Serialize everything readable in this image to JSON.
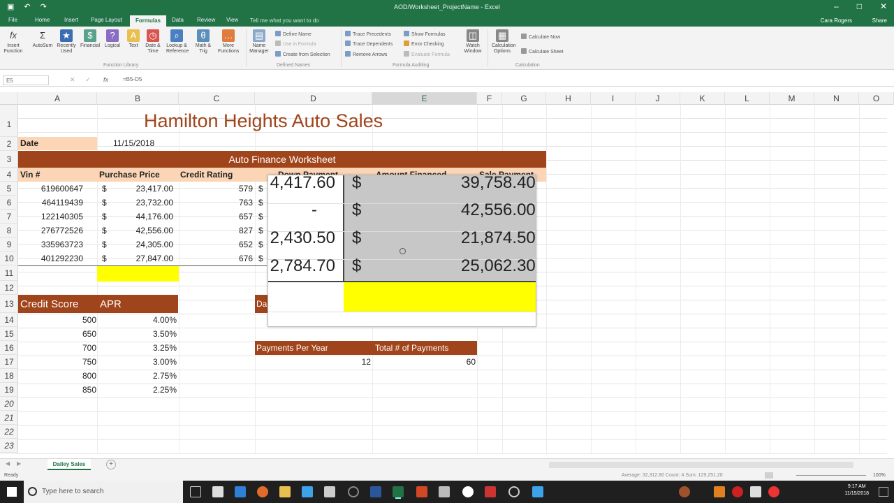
{
  "window": {
    "title": "AOD/Worksheet_ProjectName - Excel",
    "user": "Cara Rogers",
    "share": "Share"
  },
  "tabs": [
    "File",
    "Home",
    "Insert",
    "Page Layout",
    "Formulas",
    "Data",
    "Review",
    "View"
  ],
  "active_tab": "Formulas",
  "tell_me": "Tell me what you want to do",
  "ribbon": {
    "buttons": [
      "Insert Function",
      "AutoSum",
      "Recently Used",
      "Financial",
      "Logical",
      "Text",
      "Date & Time",
      "Lookup & Reference",
      "Math & Trig",
      "More Functions",
      "Name Manager"
    ],
    "small": [
      "Define Name",
      "Use in Formula",
      "Create from Selection",
      "Trace Precedents",
      "Trace Dependents",
      "Remove Arrows",
      "Show Formulas",
      "Error Checking",
      "Evaluate Formula",
      "Calculate Now",
      "Calculate Sheet"
    ],
    "big2": [
      "Watch Window",
      "Calculation Options"
    ],
    "groups": [
      "Function Library",
      "Defined Names",
      "Formula Auditing",
      "Calculation"
    ]
  },
  "formula_bar": {
    "name_box": "E5",
    "formula": "=B5-D5"
  },
  "columns": [
    "A",
    "B",
    "C",
    "D",
    "E",
    "F",
    "G",
    "H",
    "I",
    "J",
    "K",
    "L",
    "M",
    "N",
    "O"
  ],
  "rows": [
    "1",
    "2",
    "3",
    "4",
    "5",
    "6",
    "7",
    "8",
    "9",
    "10",
    "11",
    "12",
    "13",
    "14",
    "15",
    "16",
    "17",
    "18",
    "19",
    "20",
    "21",
    "22",
    "23"
  ],
  "sheet": {
    "title": "Hamilton Heights Auto Sales",
    "date_label": "Date",
    "date_value": "11/15/2018",
    "worksheet_title": "Auto Finance Worksheet",
    "headers": [
      "Vin #",
      "Purchase Price",
      "Credit Rating",
      "Down Payment",
      "Amount Financed",
      "Sale Payment"
    ],
    "vehicles": [
      {
        "vin": "619600647",
        "price": "23,417.00",
        "rating": "579"
      },
      {
        "vin": "464119439",
        "price": "23,732.00",
        "rating": "763"
      },
      {
        "vin": "122140305",
        "price": "44,176.00",
        "rating": "657"
      },
      {
        "vin": "276772526",
        "price": "42,556.00",
        "rating": "827"
      },
      {
        "vin": "335963723",
        "price": "24,305.00",
        "rating": "652"
      },
      {
        "vin": "401292230",
        "price": "27,847.00",
        "rating": "676"
      }
    ],
    "currency": "$",
    "apr_headers": [
      "Credit Score",
      "APR"
    ],
    "apr": [
      {
        "score": "500",
        "rate": "4.00%"
      },
      {
        "score": "650",
        "rate": "3.50%"
      },
      {
        "score": "700",
        "rate": "3.25%"
      },
      {
        "score": "750",
        "rate": "3.00%"
      },
      {
        "score": "800",
        "rate": "2.75%"
      },
      {
        "score": "850",
        "rate": "2.25%"
      }
    ],
    "d13_label": "Da",
    "payment_headers": [
      "Payments Per Year",
      "Total # of Payments"
    ],
    "payments_per_year": "12",
    "total_payments": "60"
  },
  "zoom": {
    "down": [
      "4,417.60",
      "-",
      "2,430.50",
      "2,784.70"
    ],
    "financed": [
      "39,758.40",
      "42,556.00",
      "21,874.50",
      "25,062.30"
    ]
  },
  "sheet_tab": "Dailey Sales",
  "status": {
    "left": "Ready",
    "mid": "Average: 32,312.80   Count: 4   Sum: 129,251.20",
    "zoom": "100%"
  },
  "taskbar": {
    "search": "Type here to search",
    "time": "9:17 AM",
    "date": "11/15/2018"
  }
}
